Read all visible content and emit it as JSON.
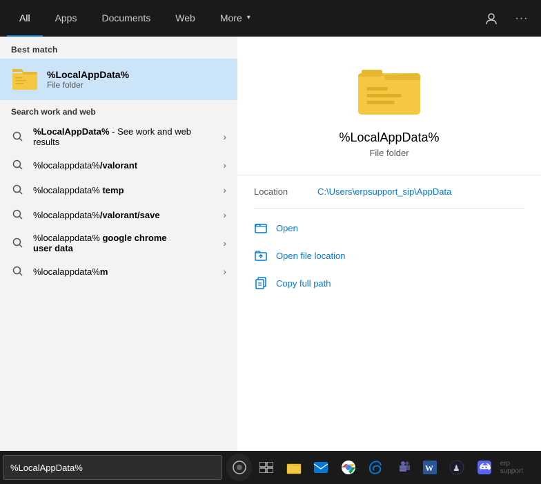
{
  "nav": {
    "tabs": [
      {
        "id": "all",
        "label": "All",
        "active": true
      },
      {
        "id": "apps",
        "label": "Apps"
      },
      {
        "id": "documents",
        "label": "Documents"
      },
      {
        "id": "web",
        "label": "Web"
      },
      {
        "id": "more",
        "label": "More",
        "hasArrow": true
      }
    ]
  },
  "left": {
    "best_match_header": "Best match",
    "best_match": {
      "name": "%LocalAppData%",
      "type": "File folder"
    },
    "search_web_header": "Search work and web",
    "search_items": [
      {
        "text": "%LocalAppData%",
        "bold": true,
        "suffix": " - See work and web results",
        "multi_line": true,
        "line2": "results"
      },
      {
        "text": "%localappdata%",
        "bold_part": "",
        "rest": "/valorant"
      },
      {
        "text": "%localappdata%",
        "rest": " temp"
      },
      {
        "text": "%localappdata%",
        "rest": "/valorant/save"
      },
      {
        "text": "%localappdata%",
        "rest": " google chrome user data",
        "multiline": true
      },
      {
        "text": "%localappdata%m",
        "rest": ""
      }
    ]
  },
  "right": {
    "title": "%LocalAppData%",
    "subtitle": "File folder",
    "location_label": "Location",
    "location_value": "C:\\Users\\erpsupport_sip\\AppData",
    "actions": [
      {
        "id": "open",
        "label": "Open"
      },
      {
        "id": "open-file-location",
        "label": "Open file location"
      },
      {
        "id": "copy-full-path",
        "label": "Copy full path"
      }
    ]
  },
  "taskbar": {
    "search_value": "%LocalAppData%",
    "buttons": [
      {
        "id": "search",
        "icon": "⊕"
      },
      {
        "id": "task-view",
        "icon": "⧉"
      },
      {
        "id": "explorer",
        "icon": "🗂"
      },
      {
        "id": "outlook",
        "icon": "📧"
      },
      {
        "id": "chrome",
        "icon": "◉"
      },
      {
        "id": "edge",
        "icon": "◈"
      },
      {
        "id": "teams",
        "icon": "💬"
      },
      {
        "id": "word",
        "icon": "W"
      },
      {
        "id": "steam",
        "icon": "♟"
      },
      {
        "id": "discord",
        "icon": "🎮"
      }
    ]
  }
}
